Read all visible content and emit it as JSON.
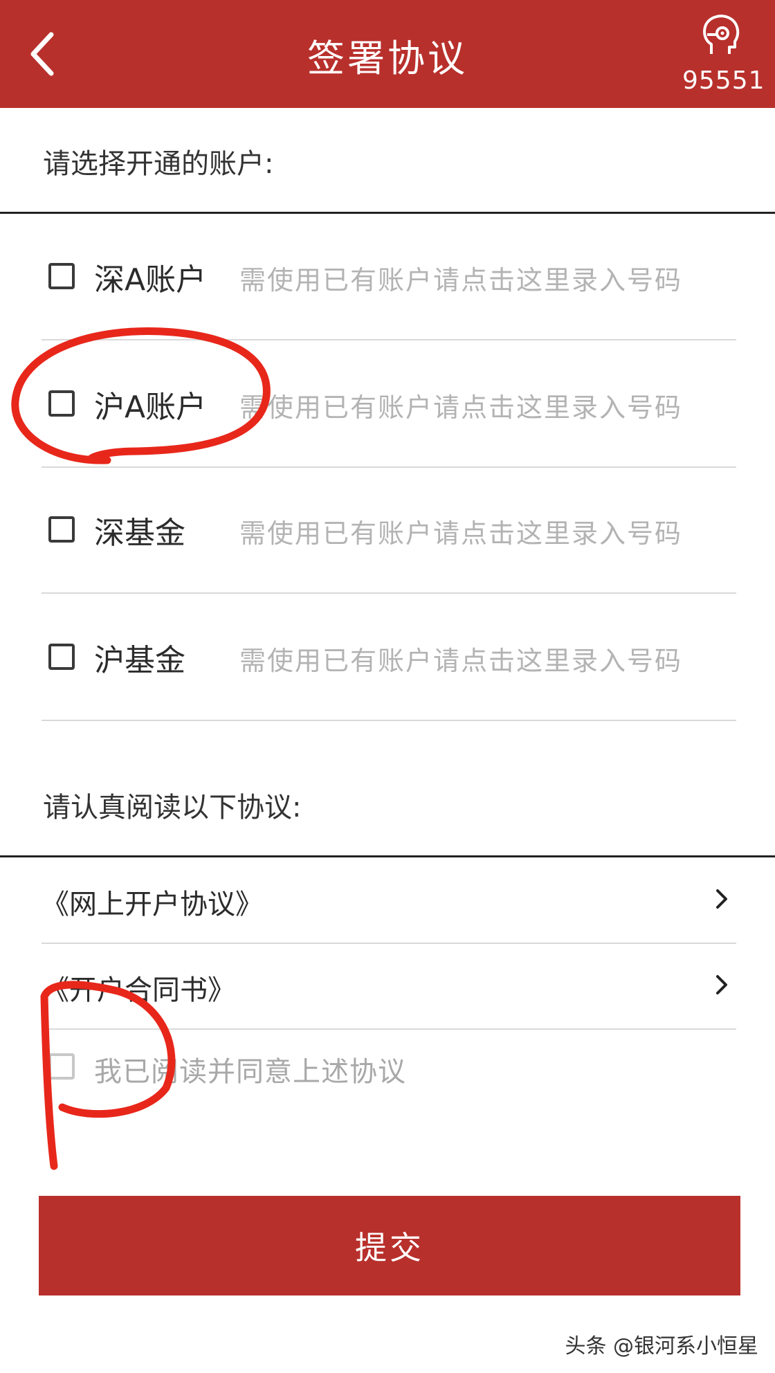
{
  "header": {
    "back_icon": "chevron-left-icon",
    "title": "签署协议",
    "service_icon": "headset-icon",
    "hotline": "95551"
  },
  "account_section": {
    "prompt": "请选择开通的账户:",
    "items": [
      {
        "label": "深A账户",
        "hint": "需使用已有账户请点击这里录入号码",
        "checked": false
      },
      {
        "label": "沪A账户",
        "hint": "需使用已有账户请点击这里录入号码",
        "checked": false
      },
      {
        "label": "深基金",
        "hint": "需使用已有账户请点击这里录入号码",
        "checked": false
      },
      {
        "label": "沪基金",
        "hint": "需使用已有账户请点击这里录入号码",
        "checked": false
      }
    ]
  },
  "agreement_section": {
    "prompt": "请认真阅读以下协议:",
    "items": [
      {
        "label": "《网上开户协议》"
      },
      {
        "label": "《开户合同书》"
      }
    ],
    "consent_label": "我已阅读并同意上述协议",
    "consent_checked": false
  },
  "submit_label": "提交",
  "watermark": "头条 @银河系小恒星",
  "colors": {
    "brand_red": "#b8302c",
    "annotation_red": "#e8271b",
    "hint_gray": "#b3b3b3"
  }
}
